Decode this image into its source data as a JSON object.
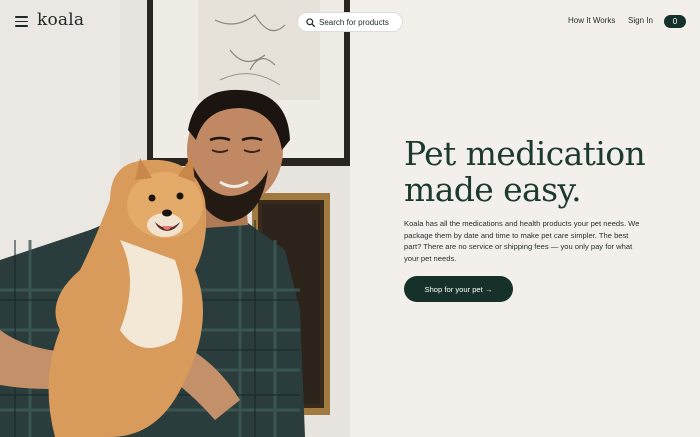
{
  "header": {
    "menu_icon": "hamburger-menu-icon",
    "logo": "koala",
    "search": {
      "placeholder": "Search for products",
      "icon": "search-icon"
    },
    "nav": {
      "how_it_works": "How It Works",
      "sign_in": "Sign In"
    },
    "cart_count": "0"
  },
  "hero": {
    "headline_line1": "Pet medication",
    "headline_line2": "made easy.",
    "body": "Koala has all the medications and health products your pet needs. We package them by date and time to make pet care simpler. The best part? There are no service or shipping fees — you only pay for what your pet needs.",
    "cta_label": "Shop for your pet →"
  },
  "colors": {
    "background": "#f3f0eb",
    "brand_dark_green": "#16302a",
    "headline_green": "#1d3a2f",
    "text": "#1f2a24"
  }
}
